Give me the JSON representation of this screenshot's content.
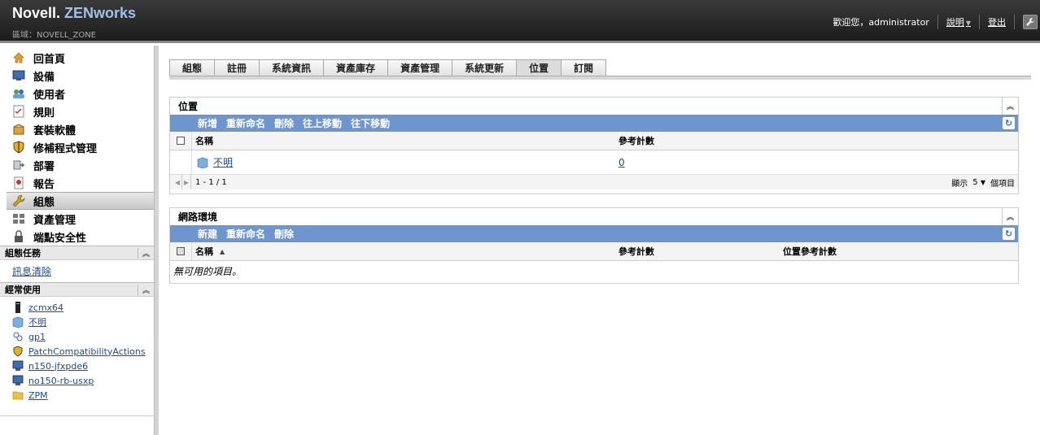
{
  "header": {
    "brand_novell": "Novell.",
    "brand_zen": "ZENworks",
    "zone": "區域：NOVELL_ZONE",
    "welcome": "歡迎您，administrator",
    "help": "說明",
    "logout": "登出"
  },
  "sidebar": {
    "nav": [
      {
        "label": "回首頁",
        "icon": "home-icon"
      },
      {
        "label": "設備",
        "icon": "monitor-icon"
      },
      {
        "label": "使用者",
        "icon": "users-icon"
      },
      {
        "label": "規則",
        "icon": "checklist-icon"
      },
      {
        "label": "套裝軟體",
        "icon": "package-icon"
      },
      {
        "label": "修補程式管理",
        "icon": "shield-icon"
      },
      {
        "label": "部署",
        "icon": "deploy-icon"
      },
      {
        "label": "報告",
        "icon": "report-icon"
      },
      {
        "label": "組態",
        "icon": "wrench-icon"
      },
      {
        "label": "資產管理",
        "icon": "asset-icon"
      },
      {
        "label": "端點安全性",
        "icon": "lock-icon"
      }
    ],
    "tasks_title": "組態任務",
    "task_link": "訊息清除",
    "fav_title": "經常使用",
    "favorites": [
      {
        "label": "zcmx64",
        "icon": "server-icon"
      },
      {
        "label": "不明",
        "icon": "location-icon"
      },
      {
        "label": "gp1",
        "icon": "group-icon"
      },
      {
        "label": "PatchCompatibilityActions",
        "icon": "shield-icon"
      },
      {
        "label": "n150-jfxpde6",
        "icon": "monitor-icon"
      },
      {
        "label": "no150-rb-usxp",
        "icon": "monitor-icon"
      },
      {
        "label": "ZPM",
        "icon": "folder-icon"
      }
    ]
  },
  "tabs": [
    "組態",
    "註冊",
    "系統資訊",
    "資產庫存",
    "資產管理",
    "系統更新",
    "位置",
    "訂閱"
  ],
  "active_tab": "位置",
  "locations_panel": {
    "title": "位置",
    "actions": [
      "新增",
      "重新命名",
      "刪除",
      "往上移動",
      "往下移動"
    ],
    "col_name": "名稱",
    "col_ref": "參考計數",
    "row_name": "不明",
    "row_ref": "0",
    "pager_range": "1 - 1 / 1",
    "show_label": "顯示",
    "page_size": "5",
    "items_label": "個項目"
  },
  "network_panel": {
    "title": "網路環境",
    "actions": [
      "新建",
      "重新命名",
      "刪除"
    ],
    "col_name": "名稱",
    "col_ref": "參考計數",
    "col_loc_ref": "位置參考計數",
    "empty": "無可用的項目。"
  },
  "colors": {
    "action_bar": "#6d96cf",
    "link": "#1f4a8c",
    "header_bg": "#2a2a2a"
  }
}
